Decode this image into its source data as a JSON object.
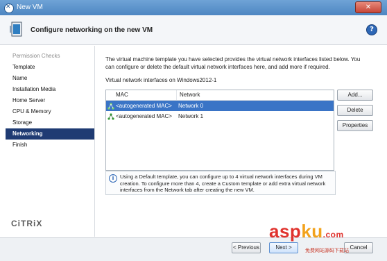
{
  "window": {
    "title": "New VM",
    "close_label": "✕"
  },
  "header": {
    "title": "Configure networking on the new VM",
    "help_label": "?"
  },
  "sidebar": {
    "items": [
      {
        "label": "Permission Checks",
        "state": "disabled"
      },
      {
        "label": "Template",
        "state": "normal"
      },
      {
        "label": "Name",
        "state": "normal"
      },
      {
        "label": "Installation Media",
        "state": "normal"
      },
      {
        "label": "Home Server",
        "state": "normal"
      },
      {
        "label": "CPU & Memory",
        "state": "normal"
      },
      {
        "label": "Storage",
        "state": "normal"
      },
      {
        "label": "Networking",
        "state": "active"
      },
      {
        "label": "Finish",
        "state": "normal"
      }
    ],
    "logo": "CiTRiX"
  },
  "main": {
    "intro": "The virtual machine template you have selected provides the virtual network interfaces listed below. You can configure or delete the default virtual network interfaces here, and add more if required.",
    "list_label": "Virtual network interfaces on Windows2012-1",
    "columns": {
      "mac": "MAC",
      "network": "Network"
    },
    "rows": [
      {
        "mac": "<autogenerated MAC>",
        "network": "Network 0",
        "selected": true
      },
      {
        "mac": "<autogenerated MAC>",
        "network": "Network 1",
        "selected": false
      }
    ],
    "buttons": {
      "add": "Add...",
      "delete": "Delete",
      "properties": "Properties"
    },
    "info": "Using a Default template, you can configure up to 4 virtual network interfaces during VM creation. To configure more than 4, create a Custom template or add extra virtual network interfaces from the Network tab after creating the new VM."
  },
  "footer": {
    "previous": "< Previous",
    "next": "Next >",
    "cancel": "Cancel"
  },
  "watermark": {
    "asp": "asp",
    "ku": "ku",
    "tail": ".com",
    "sub": "免费网站源码下载站"
  },
  "colors": {
    "selection": "#3a74c6",
    "sidebar_active": "#1f3b73",
    "titlebar": "#4d86c2"
  }
}
